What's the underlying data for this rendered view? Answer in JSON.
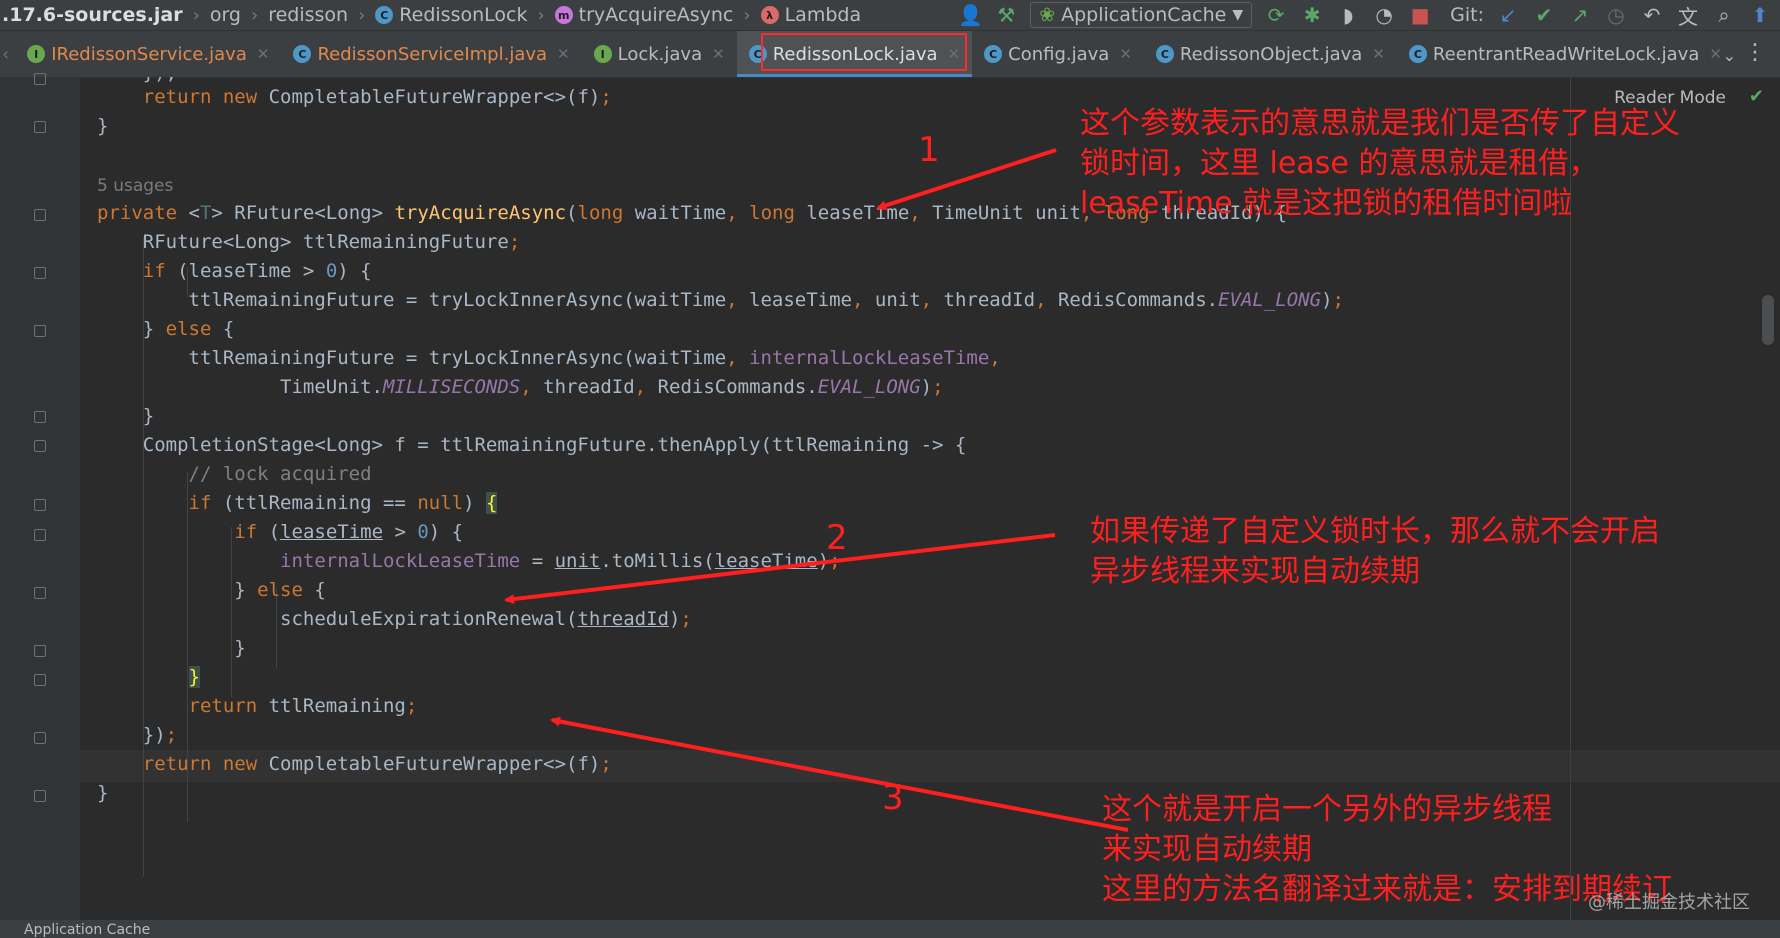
{
  "breadcrumb": [
    {
      "label": ".17.6-sources.jar",
      "icon": ""
    },
    {
      "label": "org",
      "icon": ""
    },
    {
      "label": "redisson",
      "icon": ""
    },
    {
      "label": "RedissonLock",
      "icon": "class-icon"
    },
    {
      "label": "tryAcquireAsync",
      "icon": "method-icon"
    },
    {
      "label": "Lambda",
      "icon": "lambda-icon"
    }
  ],
  "toolbar": {
    "run_config": "ApplicationCache",
    "git_label": "Git:"
  },
  "tabs": [
    {
      "label": "IRedissonService.java",
      "type": "interface",
      "color": "orange"
    },
    {
      "label": "RedissonServiceImpl.java",
      "type": "class",
      "color": "orange"
    },
    {
      "label": "Lock.java",
      "type": "interface",
      "color": "plain"
    },
    {
      "label": "RedissonLock.java",
      "type": "class",
      "color": "plain",
      "active": true
    },
    {
      "label": "Config.java",
      "type": "class",
      "color": "plain"
    },
    {
      "label": "RedissonObject.java",
      "type": "class",
      "color": "plain"
    },
    {
      "label": "ReentrantReadWriteLock.java",
      "type": "class",
      "color": "plain"
    }
  ],
  "editor": {
    "reader_mode": "Reader Mode",
    "usages": "5 usages"
  },
  "annotations": {
    "n1": "1",
    "n2": "2",
    "n3": "3",
    "note1": [
      "这个参数表示的意思就是我们是否传了自定义",
      "锁时间，这里 lease 的意思就是租借，",
      "leaseTime 就是这把锁的租借时间啦"
    ],
    "note2": [
      "如果传递了自定义锁时长，那么就不会开启",
      "异步线程来实现自动续期"
    ],
    "note3": [
      "这个就是开启一个另外的异步线程",
      "来实现自动续期",
      "这里的方法名翻译过来就是：安排到期续订"
    ]
  },
  "watermark": "@稀土掘金技术社区",
  "bottom": {
    "label": "Application Cache"
  },
  "colors": {
    "annotation": "#ff1f1f",
    "active_tab_border": "#ff2a2a",
    "editor_bg": "#2b2b2b"
  }
}
